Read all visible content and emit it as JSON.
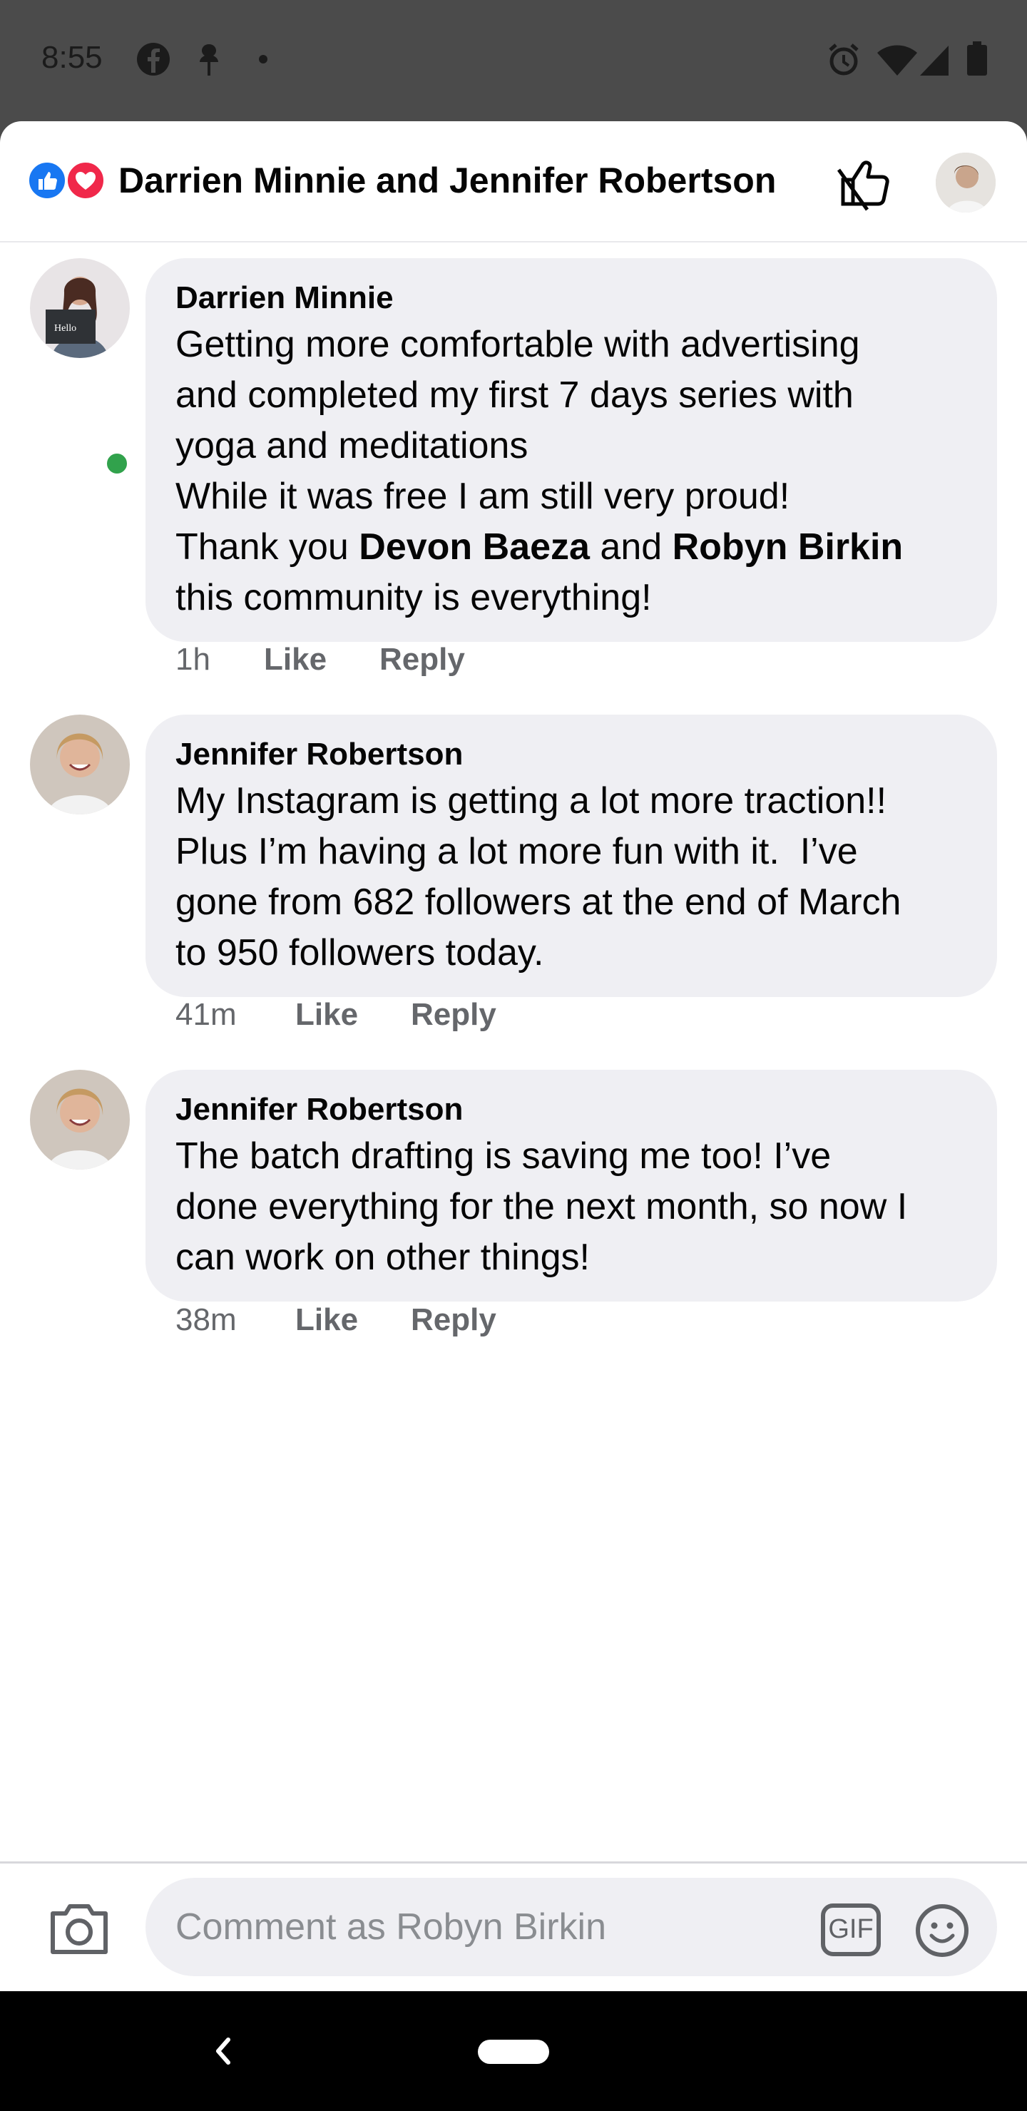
{
  "status_bar": {
    "time": "8:55",
    "left_icons": [
      "facebook-icon",
      "notification-icon",
      "dot-icon"
    ],
    "right_icons": [
      "alarm-icon",
      "wifi-icon",
      "signal-icon",
      "battery-icon"
    ]
  },
  "header": {
    "reactions": [
      "like",
      "love"
    ],
    "title": "Darrien Minnie and Jennifer Robertson",
    "unlike_icon": "thumbs-up-off-icon"
  },
  "comments": [
    {
      "author": "Darrien Minnie",
      "online": true,
      "text_lines": [
        "Getting more comfortable with advertising",
        "and completed my first 7 days series with",
        "yoga and meditations",
        "While it was free I am still very proud!"
      ],
      "thanks_prefix": "Thank you ",
      "mention_1": "Devon Baeza",
      "and_word": " and ",
      "mention_2": "Robyn Birkin",
      "last_line": "this community is everything!",
      "time": "1h",
      "like_label": "Like",
      "reply_label": "Reply"
    },
    {
      "author": "Jennifer Robertson",
      "online": false,
      "text_lines": [
        "My Instagram is getting a lot more traction!!",
        "Plus I’m having a lot more fun with it.  I’ve",
        "gone from 682 followers at the end of March",
        "to 950 followers today."
      ],
      "time": "41m",
      "like_label": "Like",
      "reply_label": "Reply"
    },
    {
      "author": "Jennifer Robertson",
      "online": false,
      "text_lines": [
        "The batch drafting is saving me too! I’ve",
        "done everything for the next month, so now I",
        "can work on other things!"
      ],
      "time": "38m",
      "like_label": "Like",
      "reply_label": "Reply"
    }
  ],
  "composer": {
    "placeholder": "Comment as Robyn Birkin",
    "gif_label": "GIF"
  },
  "colors": {
    "accent": "#1877f2",
    "love": "#f0284a",
    "bubble": "#efeff3",
    "online": "#31a24c",
    "meta_text": "#65676b"
  }
}
